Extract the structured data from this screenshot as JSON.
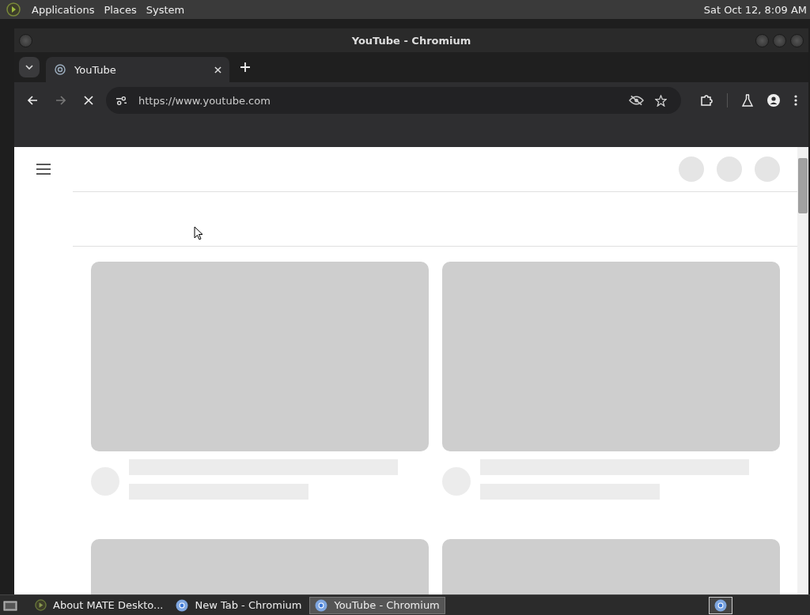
{
  "top_panel": {
    "menus": [
      "Applications",
      "Places",
      "System"
    ],
    "clock": "Sat Oct 12,  8:09 AM"
  },
  "window": {
    "title": "YouTube - Chromium"
  },
  "tabs": [
    {
      "label": "YouTube",
      "selected": true
    }
  ],
  "toolbar": {
    "loading": true,
    "forward_enabled": false,
    "url": "https://www.youtube.com"
  },
  "video_grid": [
    {
      "kind": "full"
    },
    {
      "kind": "full"
    },
    {
      "kind": "cut"
    },
    {
      "kind": "cut"
    }
  ],
  "taskbar": [
    {
      "label": "About MATE Deskto...",
      "kind": "mate",
      "selected": false
    },
    {
      "label": "New Tab - Chromium",
      "kind": "chromium",
      "selected": false
    },
    {
      "label": "YouTube - Chromium",
      "kind": "chromium",
      "selected": true
    }
  ]
}
